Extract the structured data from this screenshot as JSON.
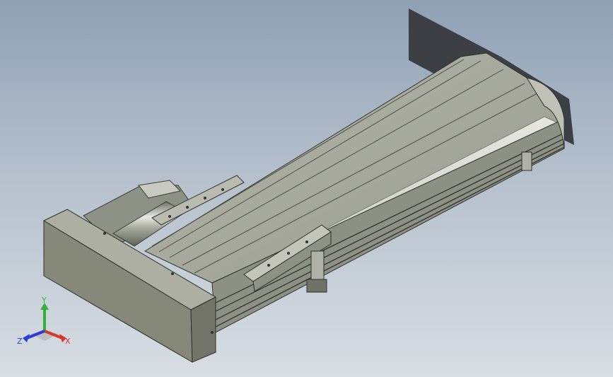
{
  "viewport": {
    "background_top": "#8fa0b4",
    "background_bottom": "#d8dde3"
  },
  "model": {
    "body_color": "#9a9d90",
    "end_block_color": "#868879",
    "shadow_color": "#3c3f44"
  },
  "triad": {
    "x_label": "X",
    "y_label": "Y",
    "z_label": "Z",
    "x_color": "#d23a2a",
    "y_color": "#2fb33a",
    "z_color": "#2a3fd2"
  }
}
